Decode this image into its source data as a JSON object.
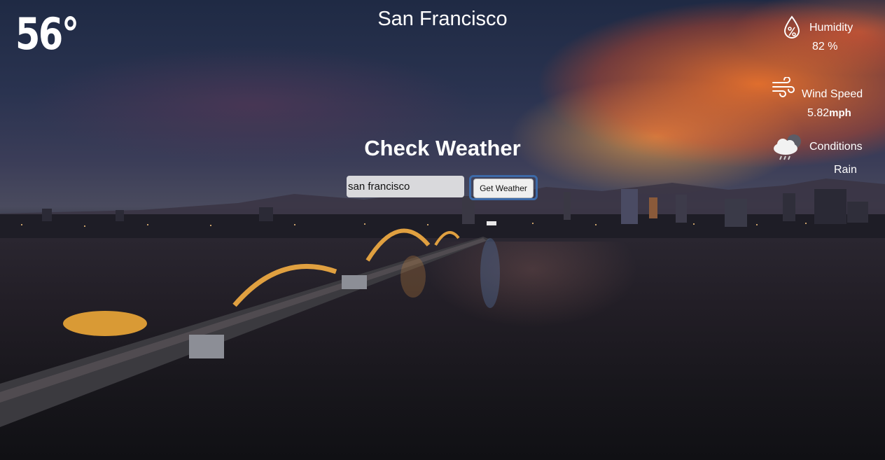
{
  "weather": {
    "temperature": "56°",
    "city": "San Francisco"
  },
  "form": {
    "title": "Check Weather",
    "input_value": "san francisco",
    "button_label": "Get Weather"
  },
  "details": {
    "humidity_label": "Humidity",
    "humidity_value": "82 %",
    "wind_label": "Wind Speed",
    "wind_value": "5.82",
    "wind_unit": "mph",
    "conditions_label": "Conditions",
    "conditions_value": "Rain"
  },
  "icons": {
    "humidity": "humidity-drop-icon",
    "wind": "wind-icon",
    "conditions": "rain-cloud-icon"
  },
  "colors": {
    "text": "#ffffff",
    "button_focus_ring": "#3d6aa8"
  }
}
